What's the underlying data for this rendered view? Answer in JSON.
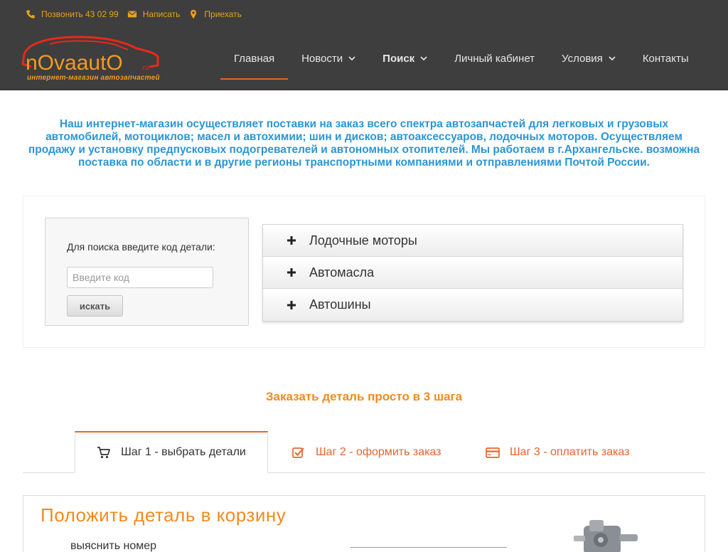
{
  "topbar": {
    "call": "Позвонить 43 02 99",
    "write": "Написать",
    "visit": "Приехать"
  },
  "logo": {
    "text": "nOvaautO",
    "suffix": ".ru",
    "tagline": "интернет-магазин автозапчастей"
  },
  "nav": {
    "items": [
      {
        "label": "Главная"
      },
      {
        "label": "Новости"
      },
      {
        "label": "Поиск"
      },
      {
        "label": "Личный кабинет"
      },
      {
        "label": "Условия"
      },
      {
        "label": "Контакты"
      }
    ]
  },
  "intro": "Наш интернет-магазин осуществляет поставки на заказ всего спектра автозапчастей для легковых и грузовых автомобилей, мотоциклов; масел и автохимии; шин и дисков; автоаксессуаров, лодочных моторов. Осуществляем продажу и установку предпусковых подогревателей и автономных отопителей. Мы работаем в г.Архангельске. возможна поставка по области и в другие регионы транспортными компаниями и отправлениями Почтой России.",
  "search": {
    "label": "Для поиска введите код детали:",
    "placeholder": "Введите код",
    "button": "искать"
  },
  "accordion": {
    "items": [
      {
        "label": "Лодочные моторы"
      },
      {
        "label": "Автомасла"
      },
      {
        "label": "Автошины"
      }
    ]
  },
  "steps": {
    "title": "Заказать деталь просто в 3 шага",
    "tabs": [
      {
        "label": "Шаг 1 - выбрать детали",
        "icon": "cart-icon"
      },
      {
        "label": "Шаг 2 - оформить заказ",
        "icon": "checkbox-icon"
      },
      {
        "label": "Шаг 3 - оплатить заказ",
        "icon": "credit-card-icon"
      }
    ]
  },
  "banner": {
    "title": "Положить деталь в корзину",
    "sub": "выяснить номер"
  },
  "colors": {
    "header_bg": "#3e3e3e",
    "accent_orange": "#e8642a",
    "intro_blue": "#2a96d6",
    "topbar_gold": "#e8a317",
    "steps_orange": "#f28a1e"
  }
}
